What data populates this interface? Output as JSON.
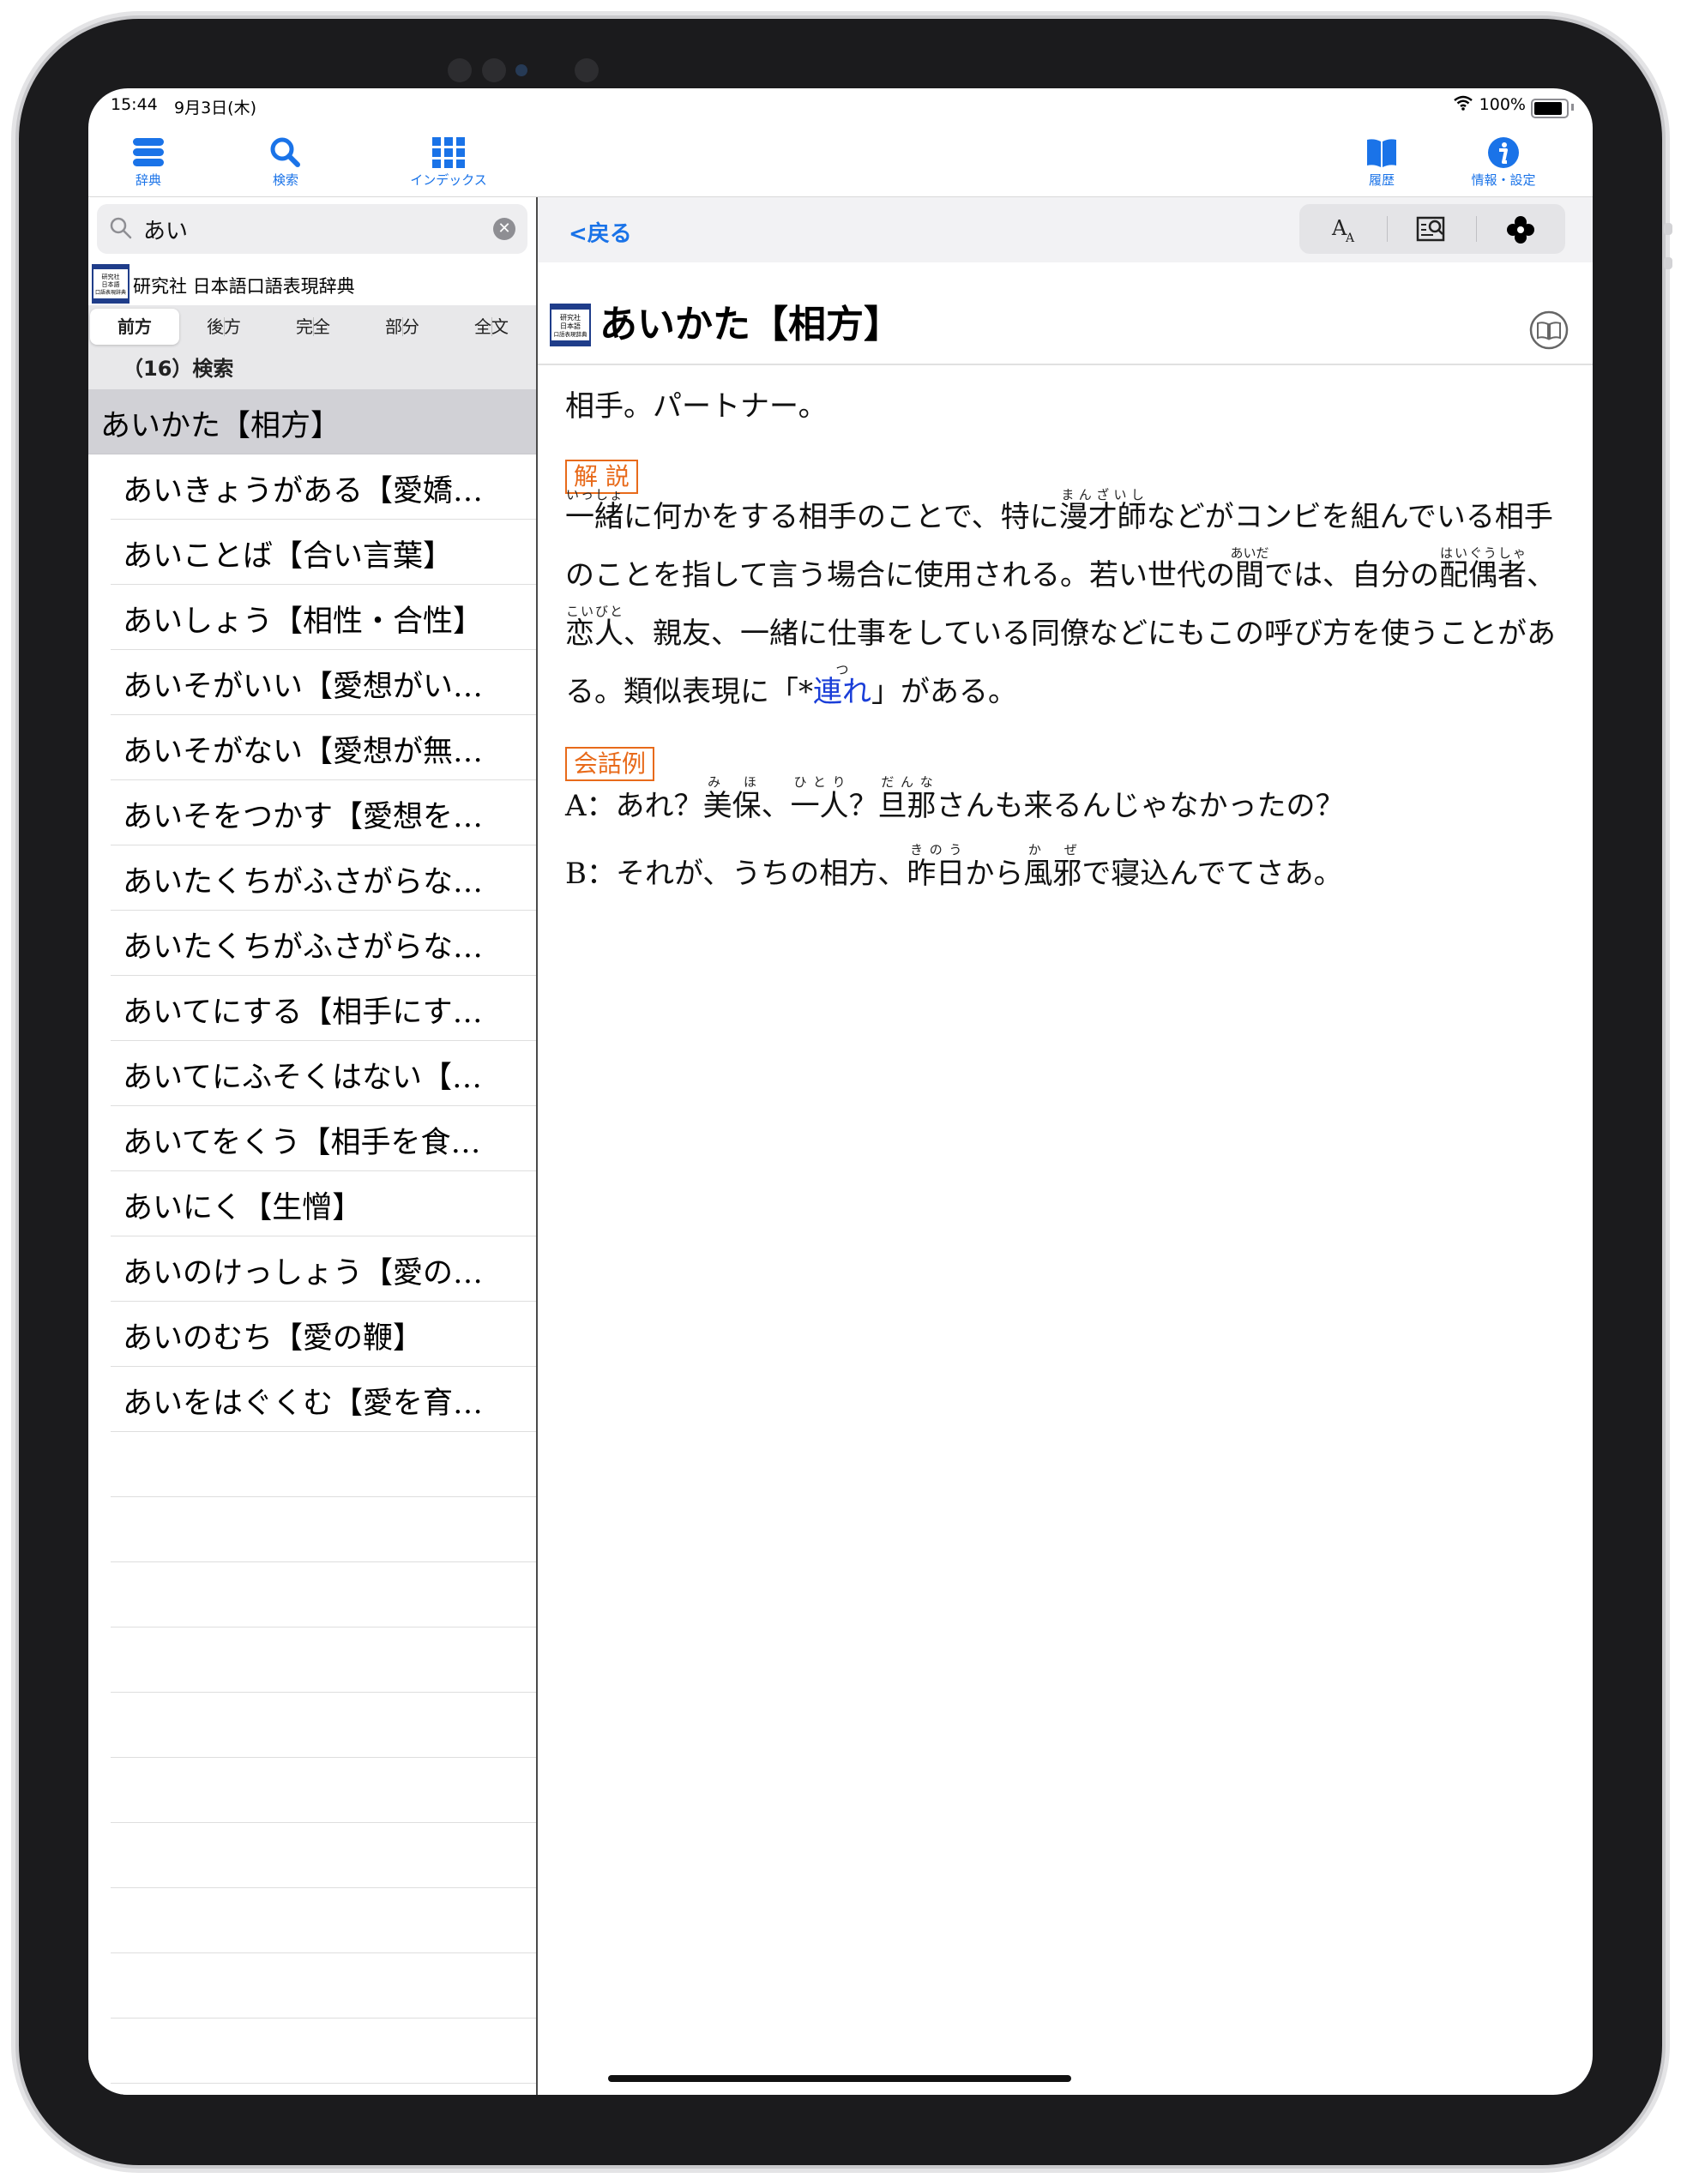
{
  "status": {
    "time": "15:44",
    "date": "9月3日(木)",
    "battery": "100%",
    "battery_level": 1.0
  },
  "toolbar": {
    "dict": "辞典",
    "search": "検索",
    "index": "インデックス",
    "history": "履歴",
    "info": "情報・設定"
  },
  "search": {
    "query": "あい"
  },
  "dictionary_name": "研究社 日本語口語表現辞典",
  "book_icon_label": "研究社 日本語 口語表現 辞典",
  "modes": [
    "前方",
    "後方",
    "完全",
    "部分",
    "全文"
  ],
  "result_count": "（16）検索",
  "results": [
    "あいかた【相方】",
    "あいきょうがある【愛嬌がある】",
    "あいことば【合い言葉】",
    "あいしょう【相性・合性】",
    "あいそがいい【愛想がいい】",
    "あいそがない【愛想が無い】",
    "あいそをつかす【愛想を尽かす】",
    "あいたくちがふさがらない【開いた口が塞がらない】",
    "あいたくちがふさがらない【開いた口が塞がらない】",
    "あいてにする【相手にする】",
    "あいてにふそくはない【相手に不足はない】",
    "あいてをくう【相手を食う】",
    "あいにく【生憎】",
    "あいのけっしょう【愛の結晶】",
    "あいのむち【愛の鞭】",
    "あいをはぐくむ【愛を育む】"
  ],
  "results_display": [
    "あいかた【相方】",
    "あいきょうがある【愛嬌…",
    "あいことば【合い言葉】",
    "あいしょう【相性・合性】",
    "あいそがいい【愛想がい…",
    "あいそがない【愛想が無…",
    "あいそをつかす【愛想を…",
    "あいたくちがふさがらな…",
    "あいたくちがふさがらな…",
    "あいてにする【相手にす…",
    "あいてにふそくはない【…",
    "あいてをくう【相手を食…",
    "あいにく【生憎】",
    "あいのけっしょう【愛の…",
    "あいのむち【愛の鞭】",
    "あいをはぐくむ【愛を育…"
  ],
  "nav": {
    "back": "<戻る",
    "font_size_icon": "font-size-icon",
    "preview_icon": "preview-icon",
    "share_icon": "clover-icon"
  },
  "entry": {
    "title": "あいかた【相方】",
    "definition": "相手。パートナー。",
    "commentary_tag": "解 説",
    "commentary": {
      "ruby_isshoni": "一緒",
      "ruby_isshoni_rt": "いっしょ",
      "t1": "に何かをする相手のことで、特に",
      "ruby_manzaishi": "漫才師",
      "ruby_manzaishi_rt": "まんざいし",
      "t2": "などがコンビを組んでいる相手のことを指して言う場合に使用される。若い世代の",
      "ruby_aida": "間",
      "ruby_aida_rt": "あいだ",
      "t3": "では、自分の",
      "ruby_haiguusha": "配偶者",
      "ruby_haiguusha_rt": "はいぐうしゃ",
      "t4": "、",
      "ruby_koibito": "恋人",
      "ruby_koibito_rt": "こいびと",
      "t5": "、親友、一緒に仕事をしている同僚などにもこの呼び方を使うことがある。類似表現に「*",
      "link": "連れ",
      "link_rt": "つ",
      "t6": "」がある。"
    },
    "dialog_tag": "会話例",
    "dialog": {
      "a_label": "A：あれ？",
      "a_ruby_miho": "美保",
      "a_ruby_miho_rt": "み ほ",
      "a_t1": "、",
      "a_ruby_hitori": "一人",
      "a_ruby_hitori_rt": "ひとり",
      "a_t2": "？",
      "a_ruby_danna": "旦那",
      "a_ruby_danna_rt": "だんな",
      "a_t3": "さんも来るんじゃなかったの？",
      "b_label": "B：それが、うちの相方、",
      "b_ruby_kinou": "昨日",
      "b_ruby_kinou_rt": "きのう",
      "b_t1": "から",
      "b_ruby_kaze": "風邪",
      "b_ruby_kaze_rt": "か ぜ",
      "b_t2": "で寝込んでてさあ。"
    }
  },
  "colors": {
    "accent": "#1a73e8",
    "tag": "#e86a1a",
    "link": "#1a3ed8",
    "selected_row": "#d1d1d6"
  }
}
